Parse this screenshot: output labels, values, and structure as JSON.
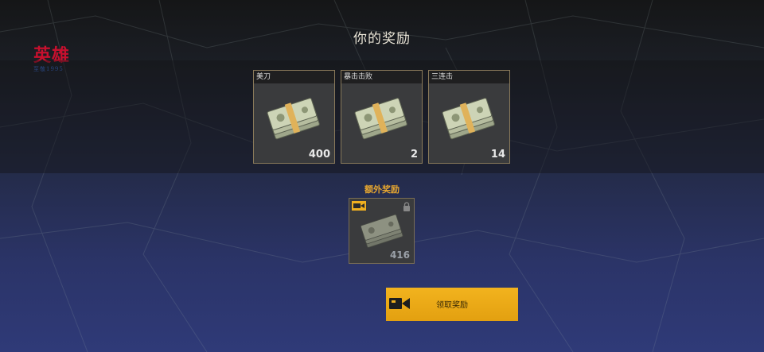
{
  "logo": {
    "main": "英雄",
    "sub": "至敬1995"
  },
  "title": "你的奖励",
  "rewards": [
    {
      "label": "美刀",
      "amount": "400"
    },
    {
      "label": "暴击击败",
      "amount": "2"
    },
    {
      "label": "三连击",
      "amount": "14"
    }
  ],
  "extra": {
    "title": "额外奖励",
    "amount": "416",
    "locked": true
  },
  "claim_button": {
    "label": "领取奖励",
    "icon": "video-camera-icon"
  },
  "colors": {
    "accent": "#f0b020",
    "extra_title": "#e6a630",
    "logo_red": "#c8102e"
  }
}
